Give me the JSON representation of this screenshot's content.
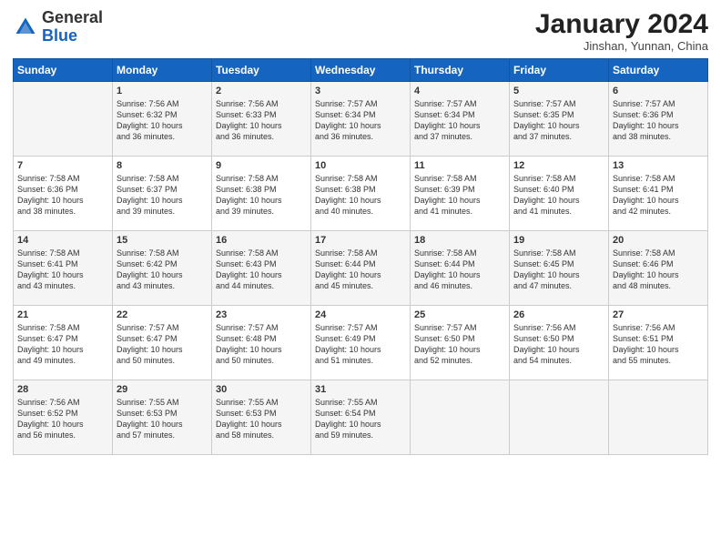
{
  "header": {
    "logo_general": "General",
    "logo_blue": "Blue",
    "title": "January 2024",
    "subtitle": "Jinshan, Yunnan, China"
  },
  "days_of_week": [
    "Sunday",
    "Monday",
    "Tuesday",
    "Wednesday",
    "Thursday",
    "Friday",
    "Saturday"
  ],
  "weeks": [
    [
      {
        "day": "",
        "info": ""
      },
      {
        "day": "1",
        "info": "Sunrise: 7:56 AM\nSunset: 6:32 PM\nDaylight: 10 hours\nand 36 minutes."
      },
      {
        "day": "2",
        "info": "Sunrise: 7:56 AM\nSunset: 6:33 PM\nDaylight: 10 hours\nand 36 minutes."
      },
      {
        "day": "3",
        "info": "Sunrise: 7:57 AM\nSunset: 6:34 PM\nDaylight: 10 hours\nand 36 minutes."
      },
      {
        "day": "4",
        "info": "Sunrise: 7:57 AM\nSunset: 6:34 PM\nDaylight: 10 hours\nand 37 minutes."
      },
      {
        "day": "5",
        "info": "Sunrise: 7:57 AM\nSunset: 6:35 PM\nDaylight: 10 hours\nand 37 minutes."
      },
      {
        "day": "6",
        "info": "Sunrise: 7:57 AM\nSunset: 6:36 PM\nDaylight: 10 hours\nand 38 minutes."
      }
    ],
    [
      {
        "day": "7",
        "info": "Sunrise: 7:58 AM\nSunset: 6:36 PM\nDaylight: 10 hours\nand 38 minutes."
      },
      {
        "day": "8",
        "info": "Sunrise: 7:58 AM\nSunset: 6:37 PM\nDaylight: 10 hours\nand 39 minutes."
      },
      {
        "day": "9",
        "info": "Sunrise: 7:58 AM\nSunset: 6:38 PM\nDaylight: 10 hours\nand 39 minutes."
      },
      {
        "day": "10",
        "info": "Sunrise: 7:58 AM\nSunset: 6:38 PM\nDaylight: 10 hours\nand 40 minutes."
      },
      {
        "day": "11",
        "info": "Sunrise: 7:58 AM\nSunset: 6:39 PM\nDaylight: 10 hours\nand 41 minutes."
      },
      {
        "day": "12",
        "info": "Sunrise: 7:58 AM\nSunset: 6:40 PM\nDaylight: 10 hours\nand 41 minutes."
      },
      {
        "day": "13",
        "info": "Sunrise: 7:58 AM\nSunset: 6:41 PM\nDaylight: 10 hours\nand 42 minutes."
      }
    ],
    [
      {
        "day": "14",
        "info": "Sunrise: 7:58 AM\nSunset: 6:41 PM\nDaylight: 10 hours\nand 43 minutes."
      },
      {
        "day": "15",
        "info": "Sunrise: 7:58 AM\nSunset: 6:42 PM\nDaylight: 10 hours\nand 43 minutes."
      },
      {
        "day": "16",
        "info": "Sunrise: 7:58 AM\nSunset: 6:43 PM\nDaylight: 10 hours\nand 44 minutes."
      },
      {
        "day": "17",
        "info": "Sunrise: 7:58 AM\nSunset: 6:44 PM\nDaylight: 10 hours\nand 45 minutes."
      },
      {
        "day": "18",
        "info": "Sunrise: 7:58 AM\nSunset: 6:44 PM\nDaylight: 10 hours\nand 46 minutes."
      },
      {
        "day": "19",
        "info": "Sunrise: 7:58 AM\nSunset: 6:45 PM\nDaylight: 10 hours\nand 47 minutes."
      },
      {
        "day": "20",
        "info": "Sunrise: 7:58 AM\nSunset: 6:46 PM\nDaylight: 10 hours\nand 48 minutes."
      }
    ],
    [
      {
        "day": "21",
        "info": "Sunrise: 7:58 AM\nSunset: 6:47 PM\nDaylight: 10 hours\nand 49 minutes."
      },
      {
        "day": "22",
        "info": "Sunrise: 7:57 AM\nSunset: 6:47 PM\nDaylight: 10 hours\nand 50 minutes."
      },
      {
        "day": "23",
        "info": "Sunrise: 7:57 AM\nSunset: 6:48 PM\nDaylight: 10 hours\nand 50 minutes."
      },
      {
        "day": "24",
        "info": "Sunrise: 7:57 AM\nSunset: 6:49 PM\nDaylight: 10 hours\nand 51 minutes."
      },
      {
        "day": "25",
        "info": "Sunrise: 7:57 AM\nSunset: 6:50 PM\nDaylight: 10 hours\nand 52 minutes."
      },
      {
        "day": "26",
        "info": "Sunrise: 7:56 AM\nSunset: 6:50 PM\nDaylight: 10 hours\nand 54 minutes."
      },
      {
        "day": "27",
        "info": "Sunrise: 7:56 AM\nSunset: 6:51 PM\nDaylight: 10 hours\nand 55 minutes."
      }
    ],
    [
      {
        "day": "28",
        "info": "Sunrise: 7:56 AM\nSunset: 6:52 PM\nDaylight: 10 hours\nand 56 minutes."
      },
      {
        "day": "29",
        "info": "Sunrise: 7:55 AM\nSunset: 6:53 PM\nDaylight: 10 hours\nand 57 minutes."
      },
      {
        "day": "30",
        "info": "Sunrise: 7:55 AM\nSunset: 6:53 PM\nDaylight: 10 hours\nand 58 minutes."
      },
      {
        "day": "31",
        "info": "Sunrise: 7:55 AM\nSunset: 6:54 PM\nDaylight: 10 hours\nand 59 minutes."
      },
      {
        "day": "",
        "info": ""
      },
      {
        "day": "",
        "info": ""
      },
      {
        "day": "",
        "info": ""
      }
    ]
  ]
}
